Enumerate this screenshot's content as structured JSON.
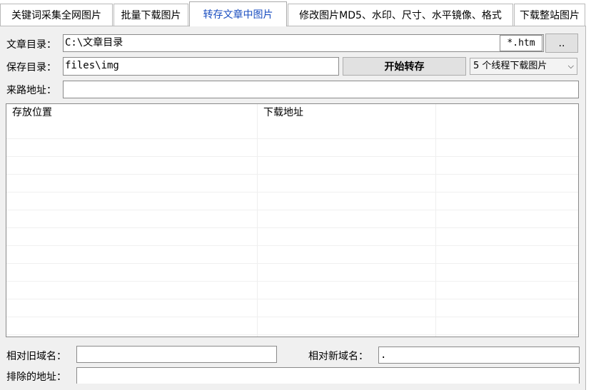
{
  "tabs": [
    {
      "label": "关键词采集全网图片"
    },
    {
      "label": "批量下载图片"
    },
    {
      "label": "转存文章中图片"
    },
    {
      "label": "修改图片MD5、水印、尺寸、水平镜像、格式"
    },
    {
      "label": "下载整站图片"
    }
  ],
  "form": {
    "article_dir_label": "文章目录：",
    "article_dir_value": "C:\\文章目录",
    "ext_filter": "*.htm",
    "browse_label": "..",
    "save_dir_label": "保存目录：",
    "save_dir_value": "files\\img",
    "start_button": "开始转存",
    "threads_select": "5 个线程下载图片",
    "referer_label": "来路地址：",
    "referer_value": ""
  },
  "list": {
    "columns": [
      "存放位置",
      "下载地址",
      ""
    ]
  },
  "bottom": {
    "old_domain_label": "相对旧域名：",
    "old_domain_value": "",
    "new_domain_label": "相对新域名：",
    "new_domain_value": ".",
    "exclude_label": "排除的地址：",
    "exclude_value": ""
  }
}
